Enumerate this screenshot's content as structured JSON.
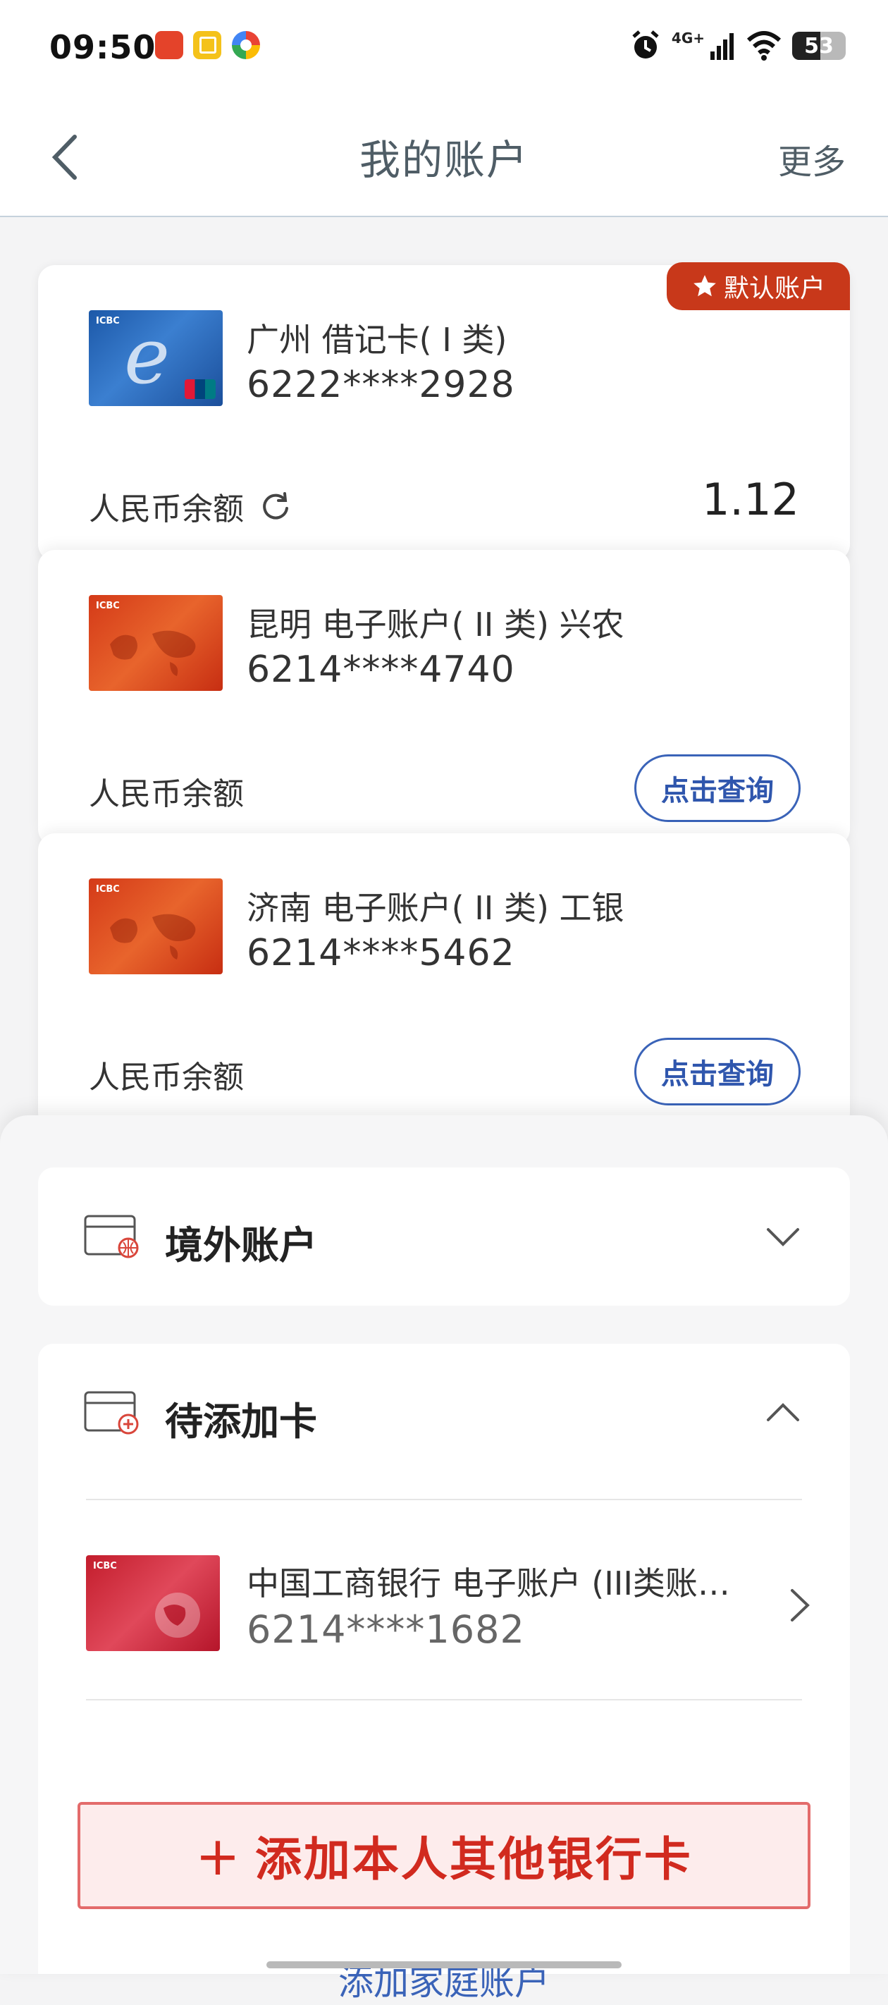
{
  "status_bar": {
    "time": "09:50",
    "app1_label": "平安银行",
    "network": "4G+",
    "battery": "53",
    "battery_level": 0.53
  },
  "header": {
    "title": "我的账户",
    "more_label": "更多"
  },
  "accounts": [
    {
      "name": "广州 借记卡( I 类)",
      "number": "6222****2928",
      "balance_label": "人民币余额",
      "balance": "1.12",
      "default_badge": "默认账户",
      "thumb_brand": "ICBC"
    },
    {
      "name": "昆明 电子账户( II 类) 兴农",
      "number": "6214****4740",
      "balance_label": "人民币余额",
      "query_label": "点击查询",
      "thumb_brand": "ICBC"
    },
    {
      "name": "济南 电子账户( II 类) 工银",
      "number": "6214****5462",
      "balance_label": "人民币余额",
      "query_label": "点击查询",
      "thumb_brand": "ICBC"
    }
  ],
  "sections": {
    "overseas": {
      "title": "境外账户",
      "state": "collapsed"
    },
    "pending": {
      "title": "待添加卡",
      "state": "expanded"
    }
  },
  "pending_cards": [
    {
      "name": "中国工商银行 电子账户 (III类账…",
      "number": "6214****1682",
      "thumb_brand": "ICBC"
    }
  ],
  "actions": {
    "add_card": "添加本人其他银行卡",
    "add_card_plus": "+",
    "add_family": "添加家庭账户"
  },
  "colors": {
    "accent_blue": "#3a63b8",
    "badge_red": "#c8381a",
    "add_btn_red": "#d12a1f"
  }
}
